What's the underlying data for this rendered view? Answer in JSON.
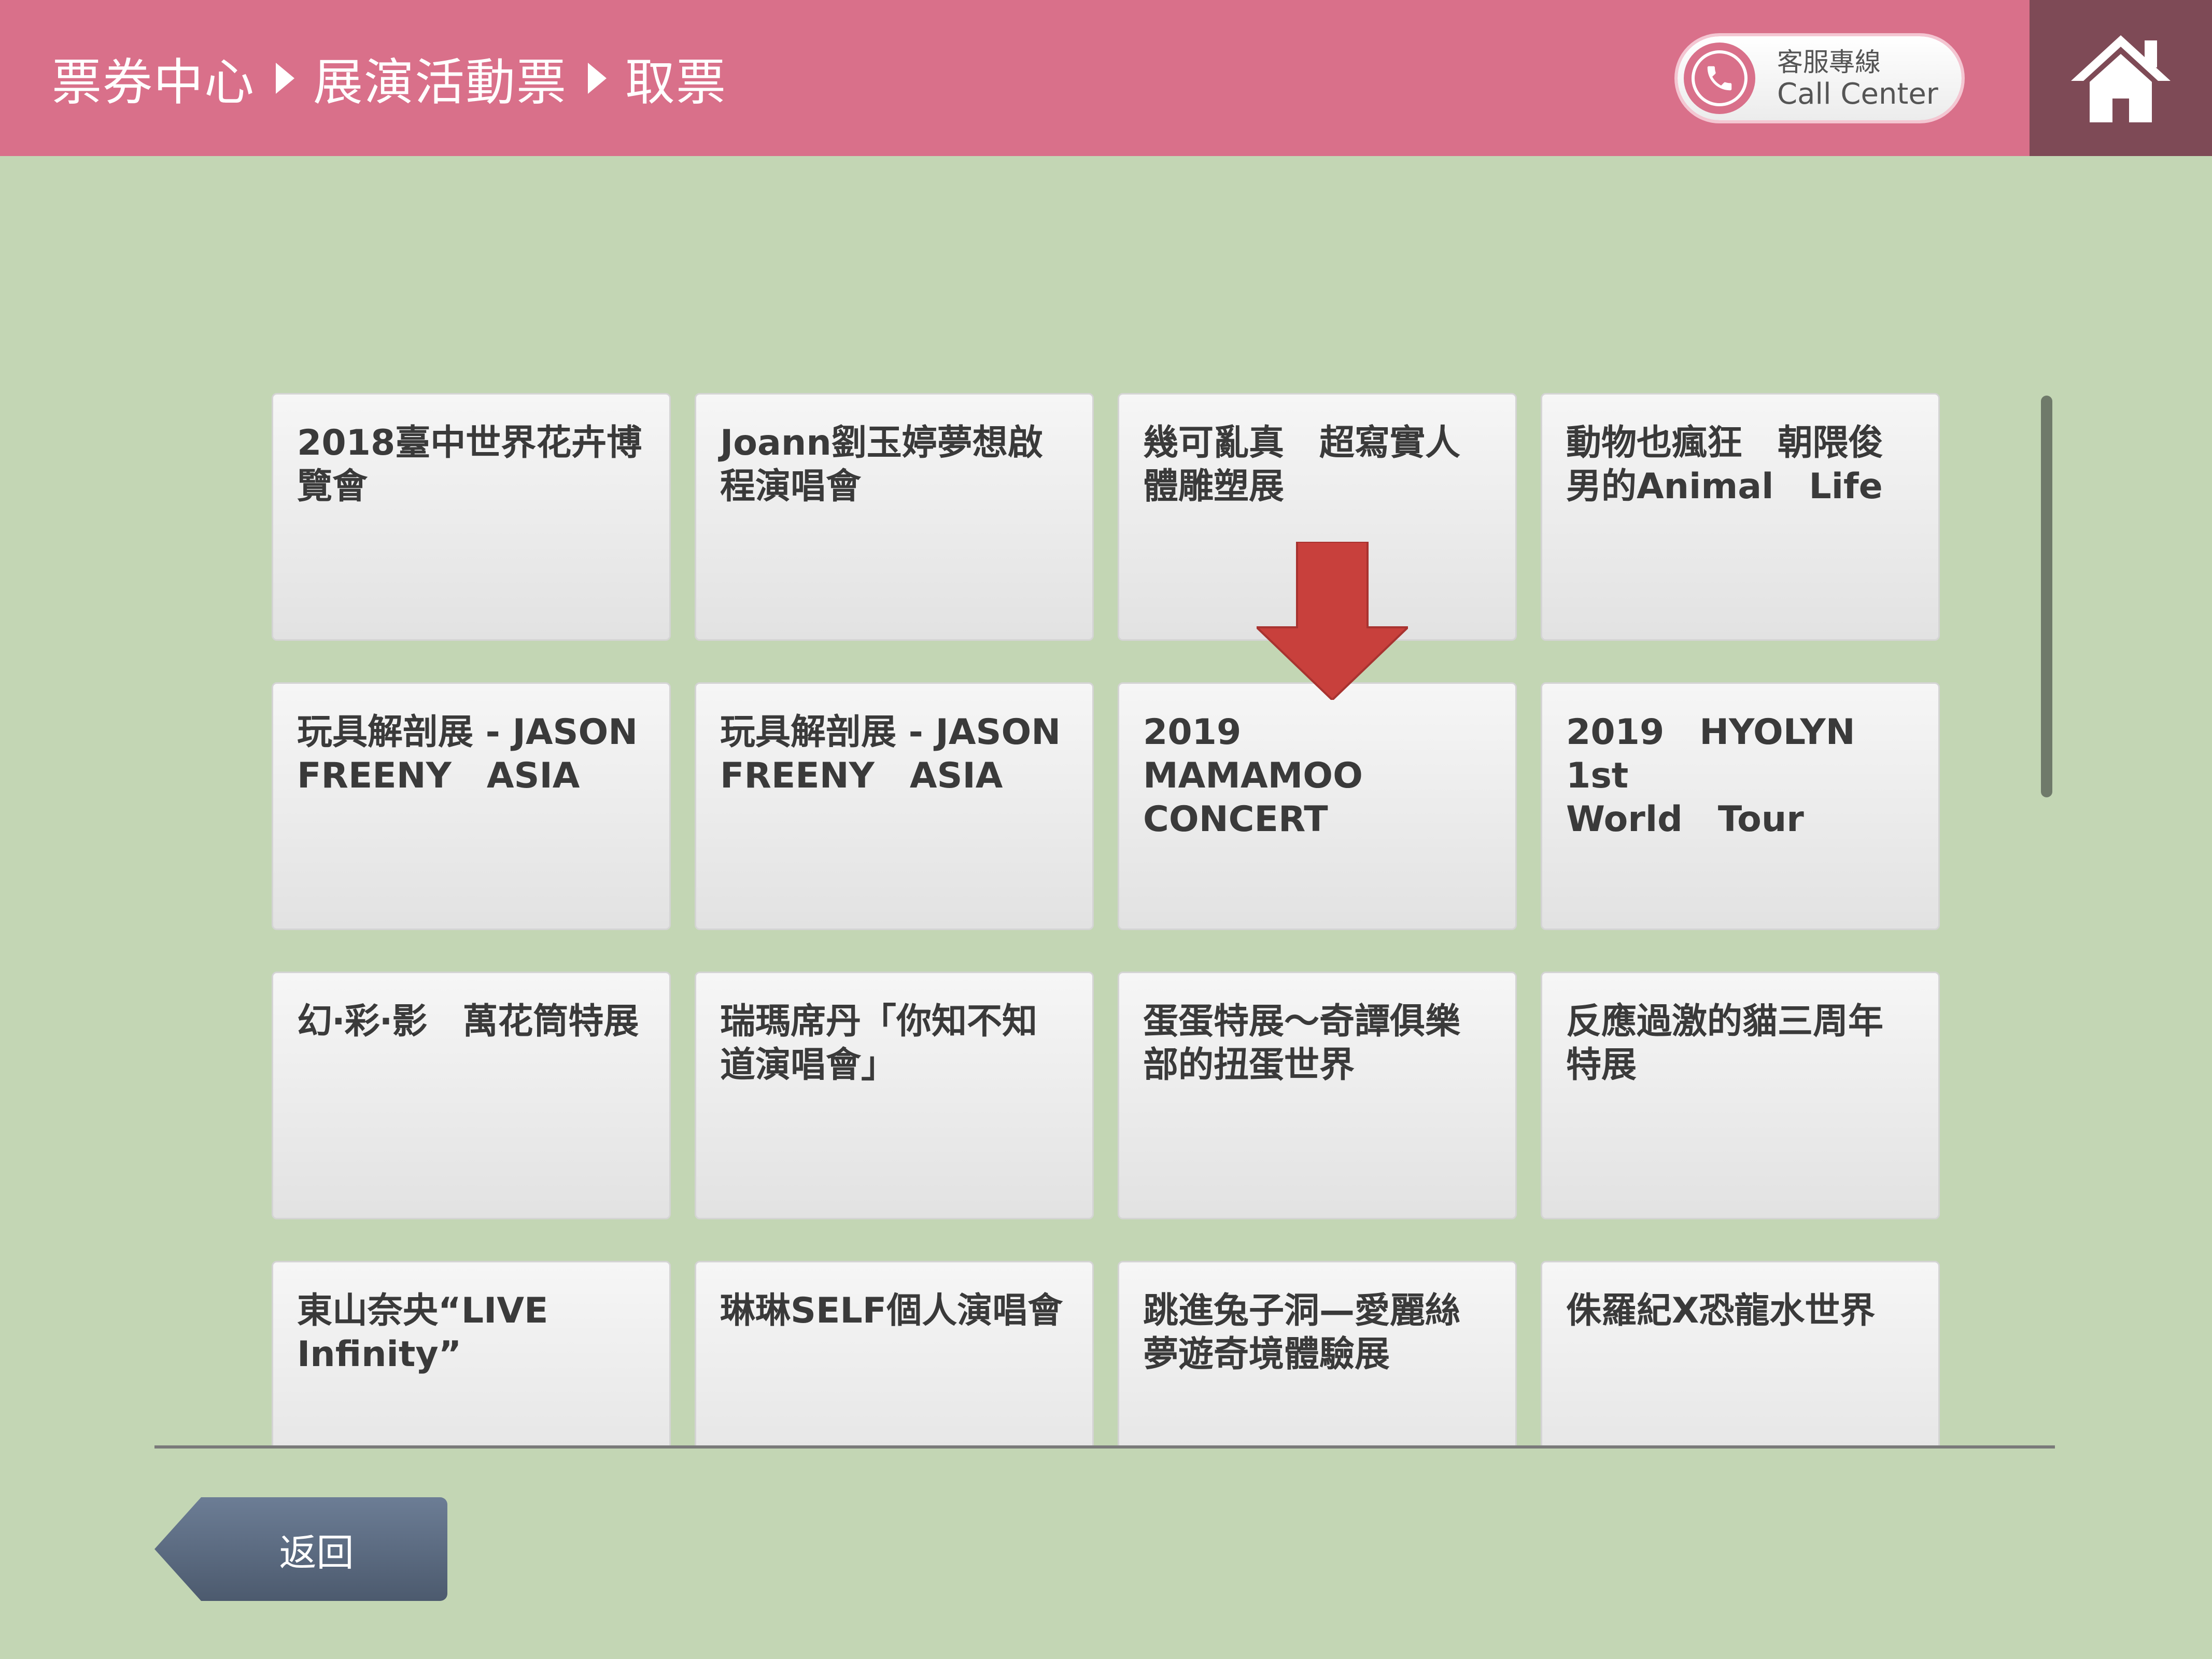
{
  "header": {
    "breadcrumbs": [
      "票券中心",
      "展演活動票",
      "取票"
    ],
    "call_center": {
      "label_zh": "客服專線",
      "label_en": "Call Center",
      "icon": "phone-icon"
    },
    "home_icon": "home-icon"
  },
  "events": [
    [
      "2018臺中世界花卉博",
      "覽會"
    ],
    [
      "Joann劉玉婷夢想啟",
      "程演唱會"
    ],
    [
      "幾可亂真　超寫實人",
      "體雕塑展"
    ],
    [
      "動物也瘋狂　朝隈俊",
      "男的Animal　Life"
    ],
    [
      "玩具解剖展 - JASON",
      "FREENY　ASIA"
    ],
    [
      "玩具解剖展 - JASON",
      "FREENY　ASIA"
    ],
    [
      "2019　MAMAMOO",
      "CONCERT"
    ],
    [
      "2019　HYOLYN　1st",
      "World　Tour"
    ],
    [
      "幻‧彩‧影　萬花筒特展",
      ""
    ],
    [
      "瑞瑪席丹「你知不知",
      "道演唱會」"
    ],
    [
      "蛋蛋特展～奇譚俱樂",
      "部的扭蛋世界"
    ],
    [
      "反應過激的貓三周年",
      "特展"
    ],
    [
      "東山奈央“LIVE",
      "Infinity”"
    ],
    [
      "琳琳SELF個人演唱會",
      ""
    ],
    [
      "跳進兔子洞—愛麗絲",
      "夢遊奇境體驗展"
    ],
    [
      "侏羅紀X恐龍水世界",
      ""
    ]
  ],
  "indicator": {
    "icon": "down-arrow-icon",
    "color": "#c8403c"
  },
  "footer": {
    "back_label": "返回"
  },
  "colors": {
    "header": "#d9708a",
    "home_box": "#7e4a56",
    "background": "#c3d6b4",
    "back_button": "#5a687e"
  }
}
